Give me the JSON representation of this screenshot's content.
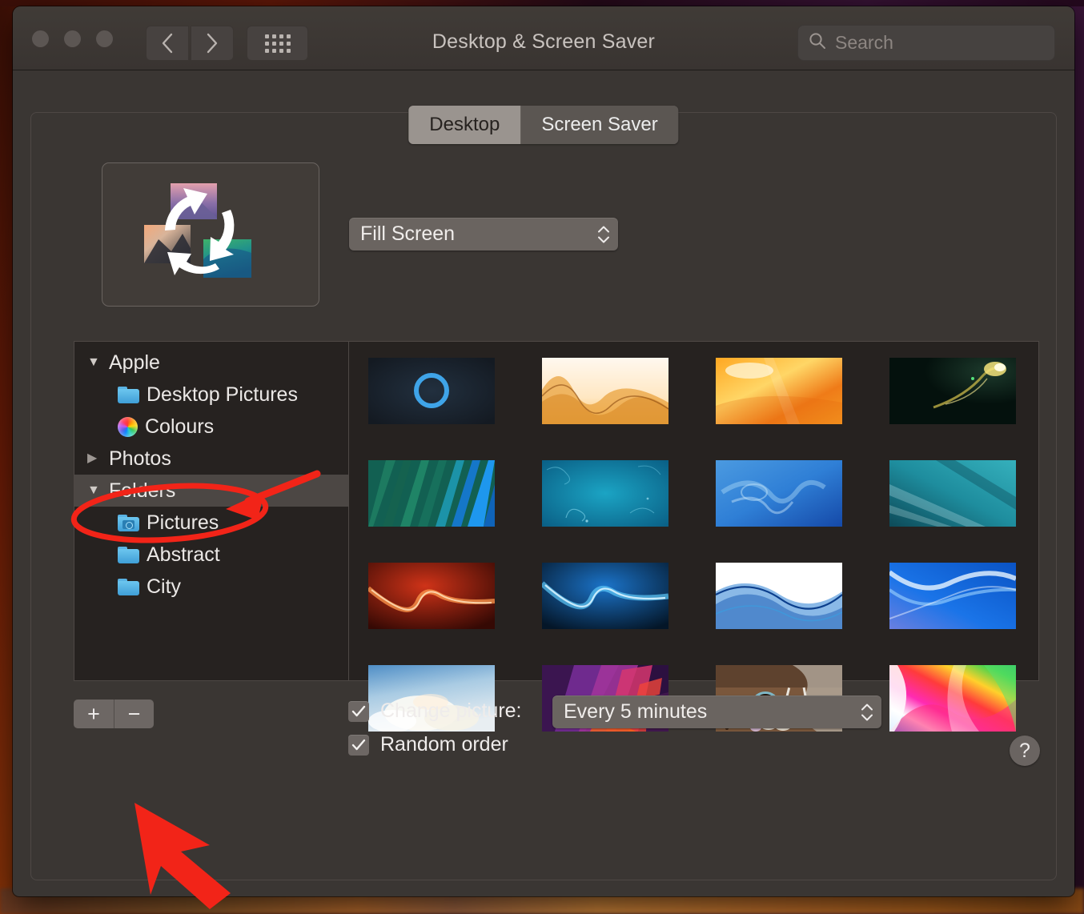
{
  "window": {
    "title": "Desktop & Screen Saver",
    "traffic_lights": [
      "close",
      "minimize",
      "zoom"
    ],
    "nav": {
      "back": "back-arrow",
      "forward": "forward-arrow",
      "grid": "show-all-grid"
    },
    "search": {
      "placeholder": "Search",
      "icon": "search-icon"
    }
  },
  "tabs": [
    {
      "label": "Desktop",
      "selected": true
    },
    {
      "label": "Screen Saver",
      "selected": false
    }
  ],
  "preview": {
    "name": "desktop-picture-preview",
    "icon": "rotating-wallpapers-icon"
  },
  "fill_popup": {
    "value": "Fill Screen",
    "chevron": "chevron-up-down-icon"
  },
  "sidebar": {
    "items": [
      {
        "label": "Apple",
        "disclosure": "open",
        "icon": "none",
        "indent": 0,
        "selected": false
      },
      {
        "label": "Desktop Pictures",
        "disclosure": "none",
        "icon": "folder-icon",
        "indent": 1,
        "selected": false
      },
      {
        "label": "Colours",
        "disclosure": "none",
        "icon": "color-wheel-icon",
        "indent": 1,
        "selected": false
      },
      {
        "label": "Photos",
        "disclosure": "closed",
        "icon": "none",
        "indent": 0,
        "selected": false
      },
      {
        "label": "Folders",
        "disclosure": "open",
        "icon": "none",
        "indent": 0,
        "selected": true
      },
      {
        "label": "Pictures",
        "disclosure": "none",
        "icon": "pictures-folder-icon",
        "indent": 1,
        "selected": false
      },
      {
        "label": "Abstract",
        "disclosure": "none",
        "icon": "folder-icon",
        "indent": 1,
        "selected": false
      },
      {
        "label": "City",
        "disclosure": "none",
        "icon": "folder-icon",
        "indent": 1,
        "selected": false
      }
    ]
  },
  "thumbnails": [
    {
      "name": "dark-blue-ring-wallpaper"
    },
    {
      "name": "orange-silk-wave-wallpaper"
    },
    {
      "name": "orange-gradient-wallpaper"
    },
    {
      "name": "green-flame-wallpaper"
    },
    {
      "name": "green-blue-stripes-wallpaper"
    },
    {
      "name": "teal-underwater-wallpaper"
    },
    {
      "name": "blue-smoke-wallpaper"
    },
    {
      "name": "teal-diagonal-wallpaper"
    },
    {
      "name": "red-swoosh-wallpaper"
    },
    {
      "name": "blue-swoosh-wallpaper"
    },
    {
      "name": "white-blue-waves-wallpaper"
    },
    {
      "name": "bright-blue-curve-wallpaper"
    },
    {
      "name": "sky-clouds-wallpaper"
    },
    {
      "name": "purple-canyon-wallpaper"
    },
    {
      "name": "coffee-cups-photo"
    },
    {
      "name": "rainbow-gradient-wallpaper"
    }
  ],
  "footer": {
    "add_label": "+",
    "remove_label": "−",
    "change_picture_label": "Change picture:",
    "change_picture_checked": true,
    "interval_value": "Every 5 minutes",
    "random_order_label": "Random order",
    "random_order_checked": true,
    "help_label": "?"
  },
  "annotations": {
    "color": "#f22418",
    "ellipse_target": "Pictures",
    "arrow_to_ellipse": "red-arrow-pointing-to-pictures",
    "arrow_to_addremove": "red-arrow-pointing-to-add-remove-buttons"
  }
}
